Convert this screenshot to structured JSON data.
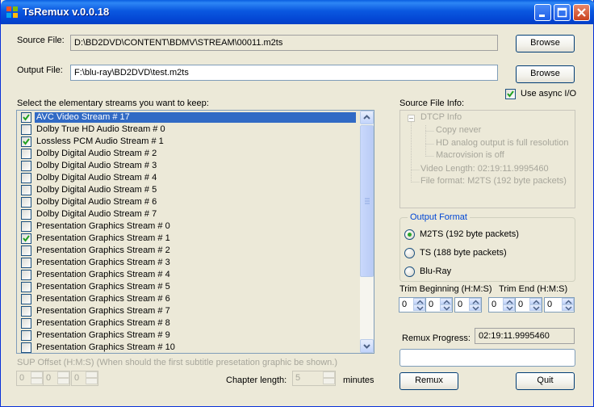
{
  "window": {
    "title": "TsRemux v.0.0.18"
  },
  "source": {
    "label": "Source File:",
    "value": "D:\\BD2DVD\\CONTENT\\BDMV\\STREAM\\00011.m2ts",
    "browse": "Browse"
  },
  "output": {
    "label": "Output File:",
    "value": "F:\\blu-ray\\BD2DVD\\test.m2ts",
    "browse": "Browse"
  },
  "async": {
    "label": "Use async I/O",
    "checked": true
  },
  "streams": {
    "label": "Select the elementary streams you want to keep:",
    "items": [
      {
        "label": "AVC Video Stream # 17",
        "checked": true,
        "selected": true
      },
      {
        "label": "Dolby True HD Audio Stream # 0",
        "checked": false
      },
      {
        "label": "Lossless PCM Audio Stream # 1",
        "checked": true
      },
      {
        "label": "Dolby Digital Audio Stream # 2",
        "checked": false
      },
      {
        "label": "Dolby Digital Audio Stream # 3",
        "checked": false
      },
      {
        "label": "Dolby Digital Audio Stream # 4",
        "checked": false
      },
      {
        "label": "Dolby Digital Audio Stream # 5",
        "checked": false
      },
      {
        "label": "Dolby Digital Audio Stream # 6",
        "checked": false
      },
      {
        "label": "Dolby Digital Audio Stream # 7",
        "checked": false
      },
      {
        "label": "Presentation Graphics Stream # 0",
        "checked": false
      },
      {
        "label": "Presentation Graphics Stream # 1",
        "checked": true
      },
      {
        "label": "Presentation Graphics Stream # 2",
        "checked": false
      },
      {
        "label": "Presentation Graphics Stream # 3",
        "checked": false
      },
      {
        "label": "Presentation Graphics Stream # 4",
        "checked": false
      },
      {
        "label": "Presentation Graphics Stream # 5",
        "checked": false
      },
      {
        "label": "Presentation Graphics Stream # 6",
        "checked": false
      },
      {
        "label": "Presentation Graphics Stream # 7",
        "checked": false
      },
      {
        "label": "Presentation Graphics Stream # 8",
        "checked": false
      },
      {
        "label": "Presentation Graphics Stream # 9",
        "checked": false
      },
      {
        "label": "Presentation Graphics Stream # 10",
        "checked": false
      }
    ]
  },
  "sourceInfo": {
    "label": "Source File Info:",
    "tree": {
      "root": "DTCP Info",
      "expander": "−",
      "children": [
        "Copy never",
        "HD analog output is full resolution",
        "Macrovision is off"
      ],
      "videoLength": "Video Length: 02:19:11.9995460",
      "fileFormat": "File format: M2TS (192 byte packets)"
    }
  },
  "outputFormat": {
    "title": "Output Format",
    "options": [
      "M2TS (192 byte packets)",
      "TS (188 byte packets)",
      "Blu-Ray"
    ],
    "selected": "M2TS (192 byte packets)"
  },
  "trim": {
    "beginLabel": "Trim Beginning (H:M:S)",
    "endLabel": "Trim End (H:M:S)",
    "begin": [
      "0",
      "0",
      "0"
    ],
    "end": [
      "0",
      "0",
      "0"
    ]
  },
  "sup": {
    "label": "SUP Offset (H:M:S) (When should the first subtitle presetation graphic be shown.)",
    "values": [
      "0",
      "0",
      "0"
    ]
  },
  "chapter": {
    "label": "Chapter length:",
    "value": "5",
    "unit": "minutes"
  },
  "progress": {
    "label": "Remux Progress:",
    "value": "02:19:11.9995460",
    "fraction": 0
  },
  "actions": {
    "remux": "Remux",
    "quit": "Quit"
  },
  "colors": {
    "titlebar": "#0a58e0",
    "selection": "#316ac5",
    "checkmark": "#21a121",
    "groupTitle": "#0046d5"
  }
}
